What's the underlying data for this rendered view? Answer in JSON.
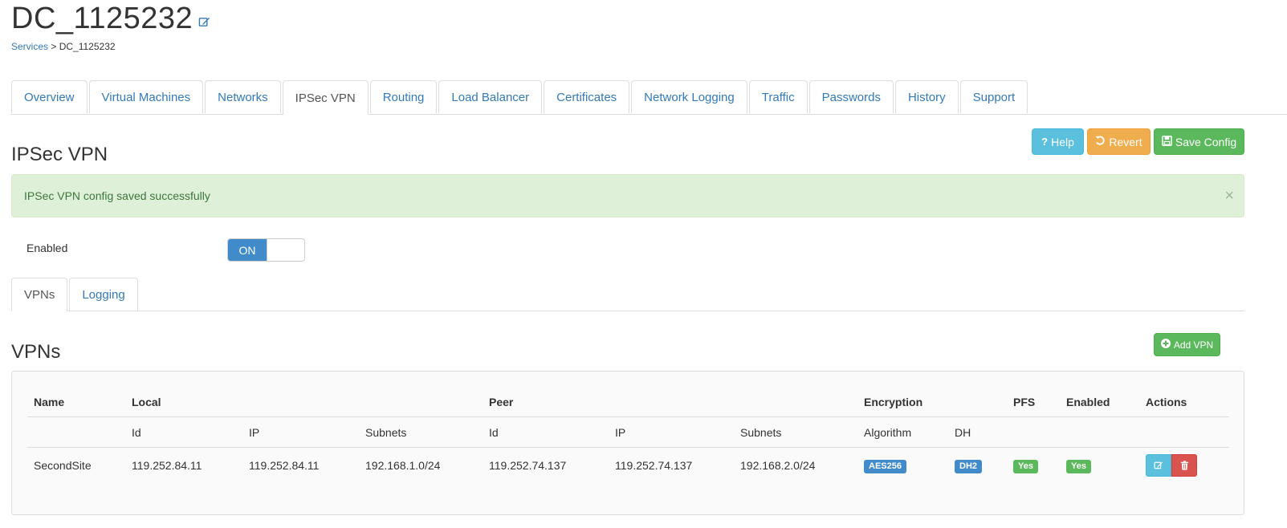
{
  "page": {
    "title": "DC_1125232",
    "breadcrumb": {
      "root": "Services",
      "sep": ">",
      "current": "DC_1125232"
    }
  },
  "tabs": [
    "Overview",
    "Virtual Machines",
    "Networks",
    "IPSec VPN",
    "Routing",
    "Load Balancer",
    "Certificates",
    "Network Logging",
    "Traffic",
    "Passwords",
    "History",
    "Support"
  ],
  "active_tab": "IPSec VPN",
  "section": {
    "title": "IPSec VPN",
    "help_label": "Help",
    "revert_label": "Revert",
    "save_label": "Save Config"
  },
  "alert": {
    "message": "IPSec VPN config saved successfully",
    "close": "×"
  },
  "enabled": {
    "label": "Enabled",
    "toggle_on": "ON"
  },
  "subtabs": [
    "VPNs",
    "Logging"
  ],
  "active_subtab": "VPNs",
  "vpns": {
    "title": "VPNs",
    "add_label": "Add VPN",
    "headers": {
      "name": "Name",
      "local": "Local",
      "peer": "Peer",
      "encryption": "Encryption",
      "pfs": "PFS",
      "enabled": "Enabled",
      "actions": "Actions"
    },
    "subheaders": {
      "id": "Id",
      "ip": "IP",
      "subnets": "Subnets",
      "peer_id": "Id",
      "peer_ip": "IP",
      "peer_subnets": "Subnets",
      "algorithm": "Algorithm",
      "dh": "DH"
    },
    "rows": [
      {
        "name": "SecondSite",
        "local_id": "119.252.84.11",
        "local_ip": "119.252.84.11",
        "local_subnets": "192.168.1.0/24",
        "peer_id": "119.252.74.137",
        "peer_ip": "119.252.74.137",
        "peer_subnets": "192.168.2.0/24",
        "algorithm": "AES256",
        "dh": "DH2",
        "pfs": "Yes",
        "enabled": "Yes"
      }
    ]
  },
  "colors": {
    "primary": "#428bca",
    "success": "#5cb85c",
    "info": "#5bc0de",
    "warning": "#f0ad4e",
    "danger": "#d9534f",
    "link": "#337ab7"
  }
}
